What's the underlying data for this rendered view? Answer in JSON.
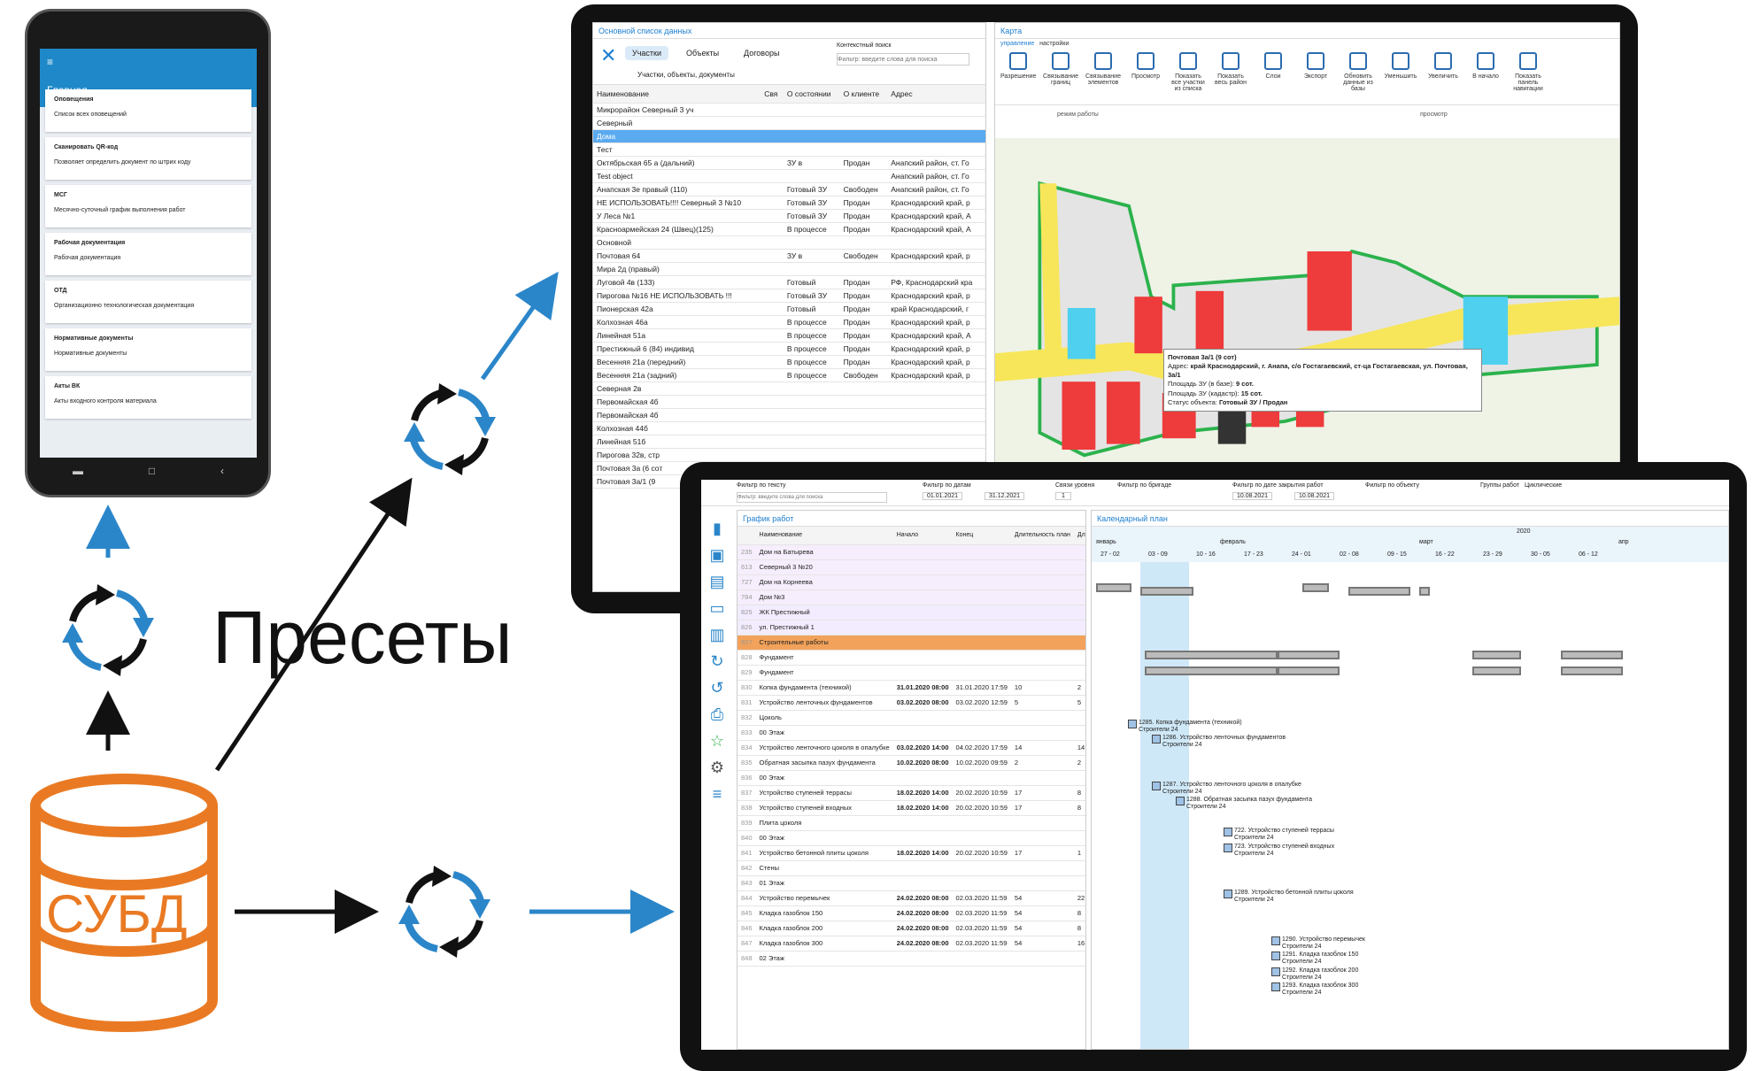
{
  "labels": {
    "presets": "Пресеты",
    "dbms": "СУБД"
  },
  "colors": {
    "accent": "#1e88c8",
    "db": "#e97a23",
    "red": "#ee3b3b",
    "road": "#f7e65a"
  },
  "phone": {
    "header": "Главная",
    "cards": [
      {
        "title": "Оповещения",
        "sub": "Список всех оповещений"
      },
      {
        "title": "Сканировать QR-код",
        "sub": "Позволяет определить документ по штрих коду"
      },
      {
        "title": "МСГ",
        "sub": "Месячно-суточный график выполнения работ"
      },
      {
        "title": "Рабочая документация",
        "sub": "Рабочая документация"
      },
      {
        "title": "ОТД",
        "sub": "Организационно технологическая документация"
      },
      {
        "title": "Нормативные документы",
        "sub": "Нормативные документы"
      },
      {
        "title": "Акты ВК",
        "sub": "Акты входного контроля материала"
      }
    ]
  },
  "list": {
    "title": "Основной список данных",
    "tabs": [
      "Участки",
      "Объекты",
      "Договоры"
    ],
    "sub": "Участки, объекты, документы",
    "search_label": "Контекстный поиск",
    "search_placeholder": "Фильтр: введите слова для поиска",
    "headers": [
      "Наименование",
      "Свя",
      "О состоянии",
      "О клиенте",
      "Адрес"
    ],
    "rows": [
      [
        "Микрорайон Северный 3 уч",
        "",
        "",
        "",
        ""
      ],
      [
        "Северный",
        "",
        "",
        "",
        ""
      ],
      [
        "Дома",
        "",
        "",
        "",
        ""
      ],
      [
        "Тест",
        "",
        "",
        "",
        ""
      ],
      [
        "Октябрьская 65 а (дальний)",
        "",
        "ЗУ в",
        "Продан",
        "Анапский район, ст. Го"
      ],
      [
        "Test object",
        "",
        "",
        "",
        "Анапский район, ст. Го"
      ],
      [
        "Анапская 3е правый (110)",
        "",
        "Готовый ЗУ",
        "Свободен",
        "Анапский район, ст. Го"
      ],
      [
        "НЕ ИСПОЛЬЗОВАТЬ!!!! Северный 3 №10",
        "",
        "Готовый ЗУ",
        "Продан",
        "Краснодарский край, р"
      ],
      [
        "У Леса №1",
        "",
        "Готовый ЗУ",
        "Продан",
        "Краснодарский край, А"
      ],
      [
        "Красноармейская 24 (Швец)(125)",
        "",
        "В процессе",
        "Продан",
        "Краснодарский край, А"
      ],
      [
        "Основной",
        "",
        "",
        "",
        ""
      ],
      [
        "Почтовая 64",
        "",
        "ЗУ в",
        "Свободен",
        "Краснодарский край, р"
      ],
      [
        "Мира 2д (правый)",
        "",
        "",
        "",
        ""
      ],
      [
        "Луговой 4в (133)",
        "",
        "Готовый",
        "Продан",
        "РФ, Краснодарский кра"
      ],
      [
        "Пирогова №16 НЕ ИСПОЛЬЗОВАТЬ !!!",
        "",
        "Готовый ЗУ",
        "Продан",
        "Краснодарский край, р"
      ],
      [
        "Пионерская 42а",
        "",
        "Готовый",
        "Продан",
        "край Краснодарский, г"
      ],
      [
        "Колхозная 46а",
        "",
        "В процессе",
        "Продан",
        "Краснодарский край, р"
      ],
      [
        "Линейная 51а",
        "",
        "В процессе",
        "Продан",
        "Краснодарский край, А"
      ],
      [
        "Престижный 6 (84) индивид",
        "",
        "В процессе",
        "Продан",
        "Краснодарский край, р"
      ],
      [
        "Весенняя 21а (передний)",
        "",
        "В процессе",
        "Продан",
        "Краснодарский край, р"
      ],
      [
        "Весенняя 21а (задний)",
        "",
        "В процессе",
        "Свободен",
        "Краснодарский край, р"
      ],
      [
        "Северная 2в",
        "",
        "",
        "",
        ""
      ],
      [
        "Первомайская 4б",
        "",
        "",
        "",
        ""
      ],
      [
        "Первомайская 4б",
        "",
        "",
        "",
        ""
      ],
      [
        "Колхозная 44б",
        "",
        "",
        "",
        ""
      ],
      [
        "Линейная 51б",
        "",
        "",
        "",
        ""
      ],
      [
        "Пирогова 32в, стр",
        "",
        "",
        "",
        ""
      ],
      [
        "Почтовая 3а (6 сот",
        "",
        "",
        "",
        ""
      ],
      [
        "Почтовая 3а/1 (9",
        "",
        "",
        "",
        ""
      ]
    ]
  },
  "mapwin": {
    "title": "Карта",
    "tabs": [
      "управление",
      "настройки"
    ],
    "tools": [
      "Разрешение",
      "Связывание границ",
      "Связывание элементов",
      "Просмотр",
      "Показать все участки из списка",
      "Показать весь район",
      "Слои",
      "Экспорт",
      "Обновить данные из базы",
      "Уменьшить",
      "Увеличить",
      "В начало",
      "Показать панель навигации"
    ],
    "group1": "режим работы",
    "group2": "просмотр",
    "popup": {
      "title": "Почтовая 3а/1 (9 сот)",
      "addr_label": "Адрес:",
      "addr": "край Краснодарский, г. Анапа, с/о Гостагаевский, ст-ца Гостагаевская, ул. Почтовая, 3а/1",
      "area_db_label": "Площадь ЗУ (в базе):",
      "area_db": "9 сот.",
      "area_cad_label": "Площадь ЗУ (кадастр):",
      "area_cad": "15 сот.",
      "status_label": "Статус объекта:",
      "status": "Готовый ЗУ / Продан"
    }
  },
  "gantt": {
    "filters": [
      "Фильтр по тексту",
      "Фильтр по датам",
      "Связи уровня",
      "Фильтр по бригаде",
      "Фильтр по дате закрытия работ",
      "Фильтр по объекту",
      "Группы работ",
      "Циклические"
    ],
    "date_from": "01.01.2021",
    "date_to": "31.12.2021",
    "level": "1",
    "close_from": "10.08.2021",
    "close_to": "10.08.2021",
    "text_placeholder": "Фильтр: введите слова для поиска",
    "title": "График работ",
    "cal_title": "Календарный план",
    "headers": [
      "Наименование",
      "Начало",
      "Конец",
      "Длительность план",
      "Длительность норма"
    ],
    "year": "2020",
    "months": [
      "январь",
      "февраль",
      "март",
      "апр"
    ],
    "weeks": [
      "27 - 02",
      "03 - 09",
      "10 - 16",
      "17 - 23",
      "24 - 01",
      "02 - 08",
      "09 - 15",
      "16 - 22",
      "23 - 29",
      "30 - 05",
      "06 - 12"
    ],
    "rows": [
      {
        "n": "235",
        "name": "Дом на Батырева",
        "s": "",
        "e": "",
        "p": "",
        "q": ""
      },
      {
        "n": "613",
        "name": "Северный 3 №20",
        "s": "",
        "e": "",
        "p": "",
        "q": ""
      },
      {
        "n": "727",
        "name": "Дом на Корнеева",
        "s": "",
        "e": "",
        "p": "",
        "q": ""
      },
      {
        "n": "784",
        "name": "Дом №3",
        "s": "",
        "e": "",
        "p": "",
        "q": ""
      },
      {
        "n": "825",
        "name": "ЖК Престижный",
        "s": "",
        "e": "",
        "p": "",
        "q": ""
      },
      {
        "n": "826",
        "name": "ул. Престижный 1",
        "s": "",
        "e": "",
        "p": "",
        "q": ""
      },
      {
        "n": "827",
        "name": "Строительные работы",
        "s": "",
        "e": "",
        "p": "",
        "q": ""
      },
      {
        "n": "828",
        "name": "Фундамент",
        "s": "",
        "e": "",
        "p": "",
        "q": ""
      },
      {
        "n": "829",
        "name": "Фундамент",
        "s": "",
        "e": "",
        "p": "",
        "q": ""
      },
      {
        "n": "830",
        "name": "Копка фундамента (техникой)",
        "s": "31.01.2020 08:00",
        "e": "31.01.2020 17:59",
        "p": "10",
        "q": "2"
      },
      {
        "n": "831",
        "name": "Устройство ленточных фундаментов",
        "s": "03.02.2020 08:00",
        "e": "03.02.2020 12:59",
        "p": "5",
        "q": "5"
      },
      {
        "n": "832",
        "name": "Цоколь",
        "s": "",
        "e": "",
        "p": "",
        "q": ""
      },
      {
        "n": "833",
        "name": "00 Этаж",
        "s": "",
        "e": "",
        "p": "",
        "q": ""
      },
      {
        "n": "834",
        "name": "Устройство ленточного цоколя в опалубке",
        "s": "03.02.2020 14:00",
        "e": "04.02.2020 17:59",
        "p": "14",
        "q": "14"
      },
      {
        "n": "835",
        "name": "Обратная засыпка пазух фундамента",
        "s": "10.02.2020 08:00",
        "e": "10.02.2020 09:59",
        "p": "2",
        "q": "2"
      },
      {
        "n": "836",
        "name": "00 Этаж",
        "s": "",
        "e": "",
        "p": "",
        "q": ""
      },
      {
        "n": "837",
        "name": "Устройство ступеней террасы",
        "s": "18.02.2020 14:00",
        "e": "20.02.2020 10:59",
        "p": "17",
        "q": "8"
      },
      {
        "n": "838",
        "name": "Устройство ступеней входных",
        "s": "18.02.2020 14:00",
        "e": "20.02.2020 10:59",
        "p": "17",
        "q": "8"
      },
      {
        "n": "839",
        "name": "Плита цоколя",
        "s": "",
        "e": "",
        "p": "",
        "q": ""
      },
      {
        "n": "840",
        "name": "00 Этаж",
        "s": "",
        "e": "",
        "p": "",
        "q": ""
      },
      {
        "n": "841",
        "name": "Устройство бетонной плиты цоколя",
        "s": "18.02.2020 14:00",
        "e": "20.02.2020 10:59",
        "p": "17",
        "q": "1"
      },
      {
        "n": "842",
        "name": "Стены",
        "s": "",
        "e": "",
        "p": "",
        "q": ""
      },
      {
        "n": "843",
        "name": "01 Этаж",
        "s": "",
        "e": "",
        "p": "",
        "q": ""
      },
      {
        "n": "844",
        "name": "Устройство перемычек",
        "s": "24.02.2020 08:00",
        "e": "02.03.2020 11:59",
        "p": "54",
        "q": "22"
      },
      {
        "n": "845",
        "name": "Кладка газоблок 150",
        "s": "24.02.2020 08:00",
        "e": "02.03.2020 11:59",
        "p": "54",
        "q": "8"
      },
      {
        "n": "846",
        "name": "Кладка газоблок 200",
        "s": "24.02.2020 08:00",
        "e": "02.03.2020 11:59",
        "p": "54",
        "q": "8"
      },
      {
        "n": "847",
        "name": "Кладка газоблок 300",
        "s": "24.02.2020 08:00",
        "e": "02.03.2020 11:59",
        "p": "54",
        "q": "16"
      },
      {
        "n": "848",
        "name": "02 Этаж",
        "s": "",
        "e": "",
        "p": "",
        "q": ""
      }
    ],
    "bars": [
      {
        "t": "1285. Копка фундамента (техникой)",
        "sub": "Строители 24"
      },
      {
        "t": "1286. Устройство ленточных фундаментов",
        "sub": "Строители 24"
      },
      {
        "t": "1287. Устройство ленточного цоколя в опалубке",
        "sub": "Строители 24"
      },
      {
        "t": "1288. Обратная засыпка пазух фундамента",
        "sub": "Строители 24"
      },
      {
        "t": "722. Устройство ступеней террасы",
        "sub": "Строители 24"
      },
      {
        "t": "723. Устройство ступеней входных",
        "sub": "Строители 24"
      },
      {
        "t": "1289. Устройство бетонной плиты цоколя",
        "sub": "Строители 24"
      },
      {
        "t": "1290. Устройство перемычек",
        "sub": "Строители 24"
      },
      {
        "t": "1291. Кладка газоблок 150",
        "sub": "Строители 24"
      },
      {
        "t": "1292. Кладка газоблок 200",
        "sub": "Строители 24"
      },
      {
        "t": "1293. Кладка газоблок 300",
        "sub": "Строители 24"
      }
    ]
  }
}
